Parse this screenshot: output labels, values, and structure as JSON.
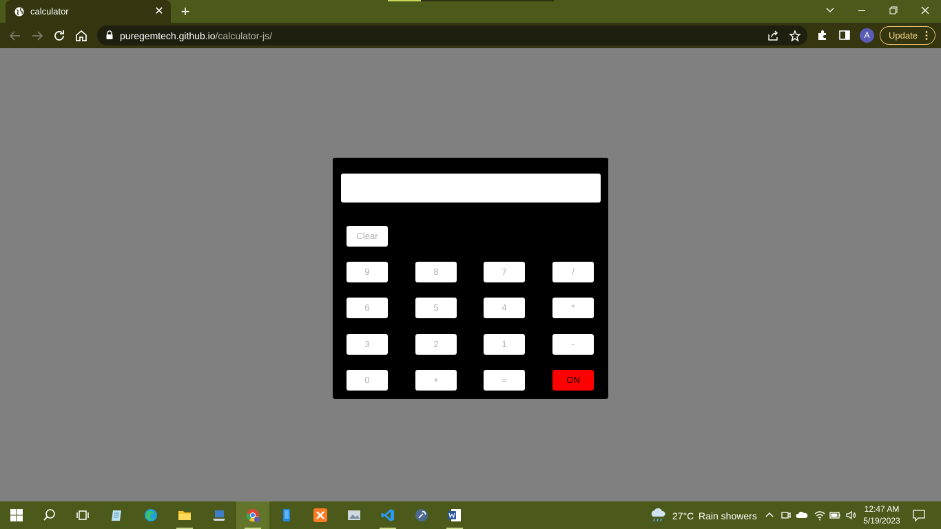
{
  "browser": {
    "tab_title": "calculator",
    "url_domain": "puregemtech.github.io",
    "url_path": "/calculator-js/",
    "update_label": "Update",
    "avatar_letter": "A"
  },
  "calculator": {
    "display_value": "",
    "clear_label": "Clear",
    "rows": [
      [
        "9",
        "8",
        "7",
        "/"
      ],
      [
        "6",
        "5",
        "4",
        "*"
      ],
      [
        "3",
        "2",
        "1",
        "-"
      ],
      [
        "0",
        "+",
        "=",
        "ON"
      ]
    ],
    "on_color": "#ff0000"
  },
  "taskbar": {
    "weather_temp": "27°C",
    "weather_desc": "Rain showers",
    "time": "12:47 AM",
    "date": "5/19/2023"
  },
  "colors": {
    "page_background": "#808080",
    "titlebar": "#4b5a1a",
    "toolbar": "#35350f"
  }
}
